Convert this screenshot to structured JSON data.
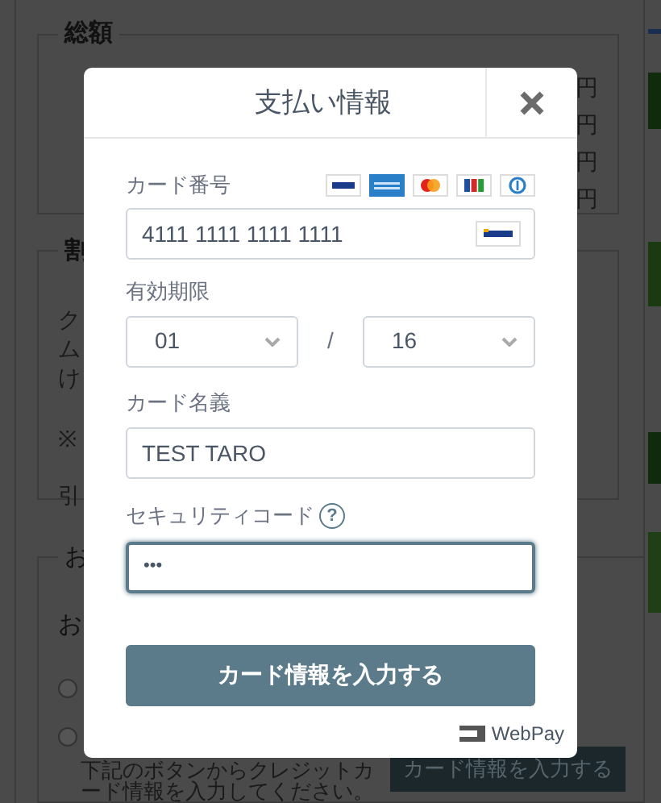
{
  "background": {
    "total": {
      "legend": "総額",
      "amounts": [
        "円",
        "円",
        "円",
        "円"
      ]
    },
    "discount": {
      "legend": "割",
      "lines": [
        "ク",
        "ム",
        "け",
        "※",
        "引"
      ]
    },
    "payment": {
      "legend": "お",
      "subheading": "お",
      "options": [
        {
          "selected": false
        },
        {
          "selected": false
        }
      ],
      "note": [
        "下記のボタンからクレジットカ",
        "ード情報を入力してください。"
      ],
      "button": "カード情報を入力する"
    }
  },
  "modal": {
    "title": "支払い情報",
    "card_number": {
      "label": "カード番号",
      "value": "4111 1111 1111 1111"
    },
    "expiry": {
      "label": "有効期限",
      "month": "01",
      "separator": "/",
      "year": "16"
    },
    "name": {
      "label": "カード名義",
      "value": "TEST TARO"
    },
    "security": {
      "label": "セキュリティコード",
      "help": "?",
      "value": "•••",
      "focused": true
    },
    "submit": "カード情報を入力する",
    "brand": "WebPay"
  }
}
